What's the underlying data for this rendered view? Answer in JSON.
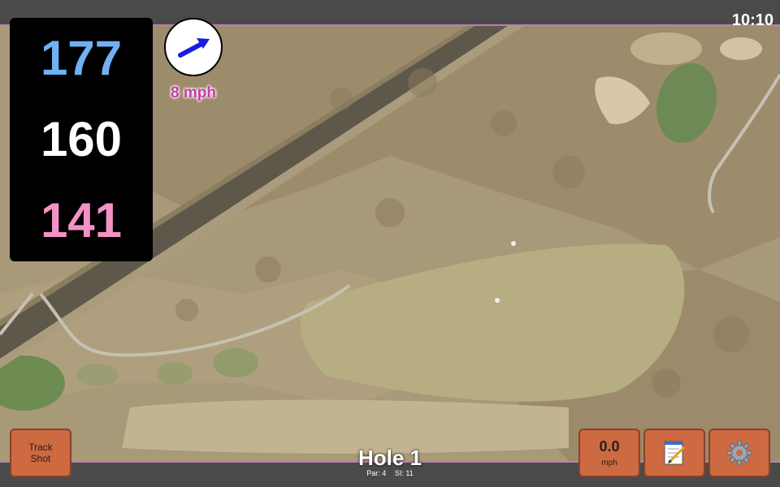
{
  "status_bar": {
    "time": "10:10"
  },
  "yardages": {
    "back": "177",
    "center": "160",
    "front": "141"
  },
  "wind": {
    "speed_label": "8 mph",
    "icon": "wind-direction-arrow-icon"
  },
  "hole": {
    "title": "Hole 1",
    "par": "Par: 4",
    "si": "SI: 11"
  },
  "buttons": {
    "track_shot": "Track\nShot",
    "speed_value": "0.0",
    "speed_unit": "mph",
    "notes_icon": "notepad-icon",
    "settings_icon": "gear-icon"
  },
  "colors": {
    "back_yardage": "#6fb1f2",
    "center_yardage": "#ffffff",
    "front_yardage": "#f292c7",
    "button_orange": "#cd6a42",
    "wind_text": "#c83ca8"
  }
}
